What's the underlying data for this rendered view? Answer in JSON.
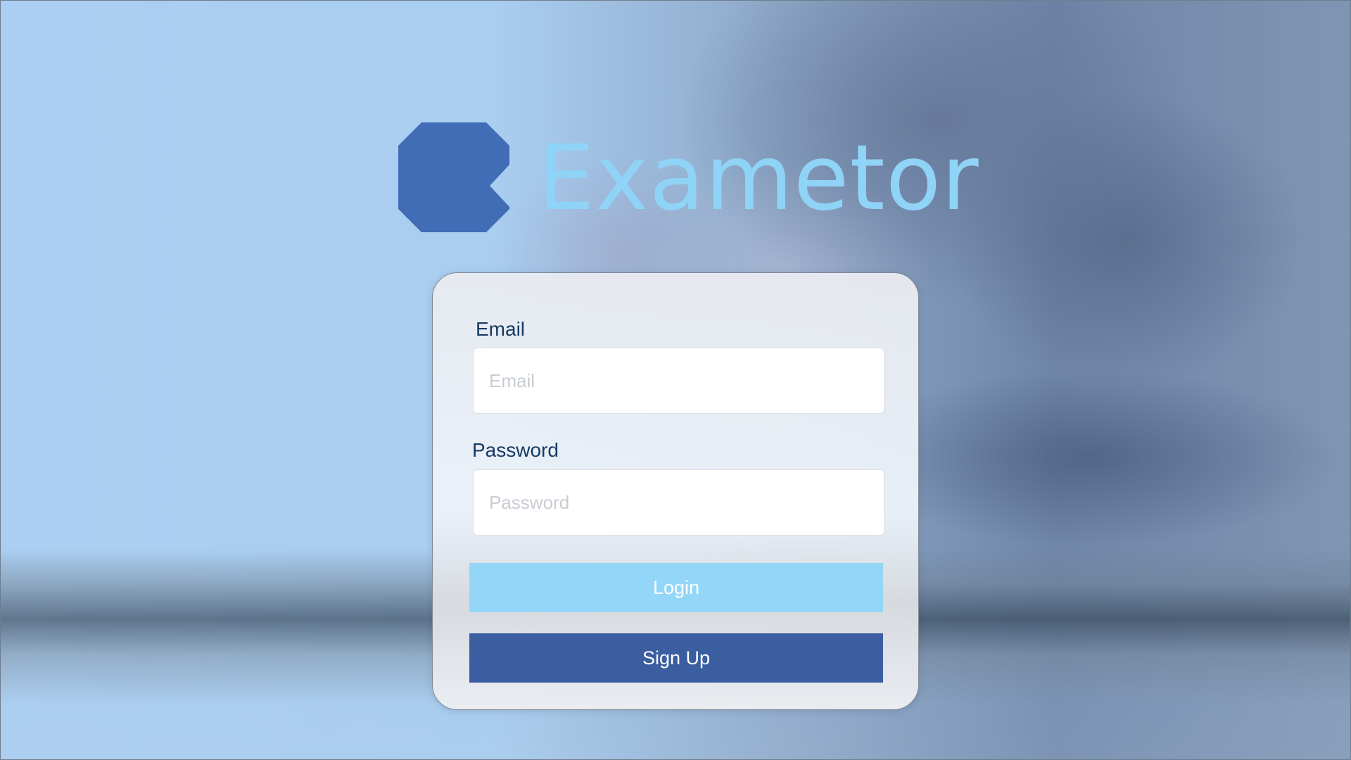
{
  "brand": {
    "name": "Exametor",
    "logo_icon": "exametor-logo-icon",
    "logo_color": "#416cb6",
    "text_color": "#8fd3f6"
  },
  "login_form": {
    "email_label": "Email",
    "email_placeholder": "Email",
    "email_value": "",
    "password_label": "Password",
    "password_placeholder": "Password",
    "password_value": "",
    "login_button": "Login",
    "signup_button": "Sign Up"
  },
  "colors": {
    "login_button": "#93d6f7",
    "signup_button": "#3b5ea0",
    "label_text": "#163a63"
  }
}
